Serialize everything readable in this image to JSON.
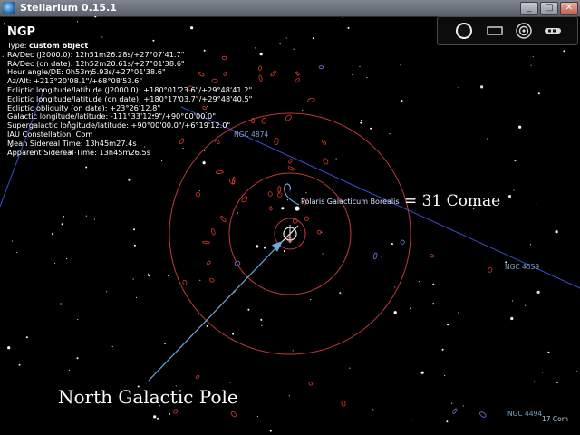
{
  "window": {
    "title": "Stellarium 0.15.1",
    "minimize_label": "_",
    "maximize_label": "□",
    "close_label": "✕"
  },
  "toolbar": {
    "buttons": [
      {
        "name": "star-icon"
      },
      {
        "name": "rectangle-icon"
      },
      {
        "name": "target-icon"
      },
      {
        "name": "telescope-icon"
      }
    ]
  },
  "info_panel": {
    "object_name": "NGP",
    "type_label": "Type: ",
    "type_value": "custom object",
    "lines": [
      "RA/Dec (J2000.0): 12h51m26.28s/+27°07'41.7\"",
      "RA/Dec (on date): 12h52m20.61s/+27°01'38.6\"",
      "Hour angle/DE: 0h53m5.93s/+27°01'38.6\"",
      "Az/Alt: +213°20'08.1\"/+68°08'53.6\"",
      "Ecliptic longitude/latitude (J2000.0): +180°01'23.6\"/+29°48'41.2\"",
      "Ecliptic longitude/latitude (on date): +180°17'03.7\"/+29°48'40.5\"",
      "Ecliptic obliquity (on date): +23°26'12.8\"",
      "Galactic longitude/latitude: -111°33'12.9\"/+90°00'00.0\"",
      "Supergalactic longitude/latitude: +90°00'00.0\"/+6°19'12.0\"",
      "IAU Constellation: Com",
      "Mean Sidereal Time: 13h45m27.4s",
      "Apparent Sidereal Time: 13h45m26.5s"
    ]
  },
  "sky_labels": {
    "polaris": "Polaris Galacticum Borealis",
    "ngc4559": "NGC 4559",
    "ngc4494": "NGC 4494",
    "com17": "17 Com",
    "ngc4874": "NGC 4874"
  },
  "annotations": {
    "north_galactic_pole": "North Galactic Pole",
    "comae": "= 31 Comae"
  },
  "colors": {
    "circle": "#c0393b",
    "galactic_line": "#3b4fd0",
    "annotation_arrow": "#6fa8dc",
    "galaxy": "#d43a2a"
  }
}
